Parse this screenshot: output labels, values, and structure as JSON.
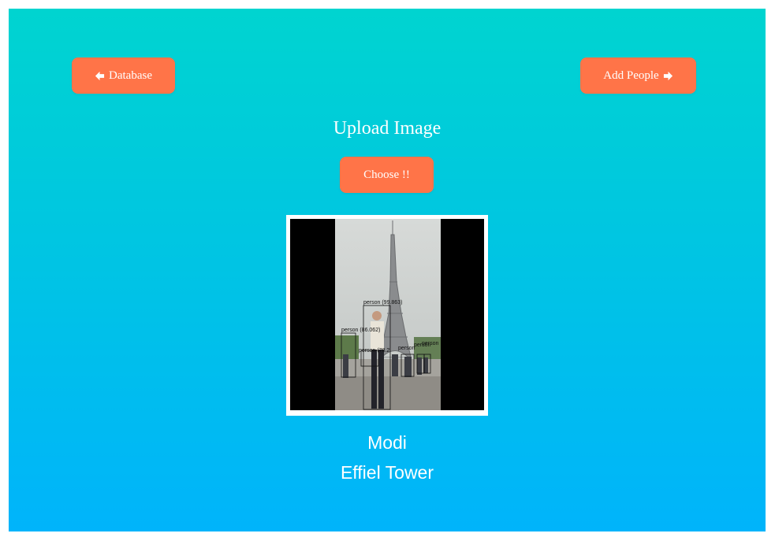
{
  "nav": {
    "database_label": "Database",
    "add_people_label": "Add People"
  },
  "upload": {
    "title": "Upload Image",
    "choose_label": "Choose !!"
  },
  "image": {
    "detections": [
      {
        "label": "person (99.863)"
      },
      {
        "label": "person (86.062)"
      },
      {
        "label": "person (78.2"
      },
      {
        "label": "person"
      },
      {
        "label": "person"
      },
      {
        "label": "person"
      }
    ]
  },
  "results": {
    "person": "Modi",
    "landmark": "Effiel Tower"
  },
  "colors": {
    "button": "#ff7448",
    "gradient_top": "#00d4d0",
    "gradient_bottom": "#00b4fb"
  },
  "icons": {
    "left": "arrow-left-icon",
    "right": "arrow-right-icon"
  }
}
